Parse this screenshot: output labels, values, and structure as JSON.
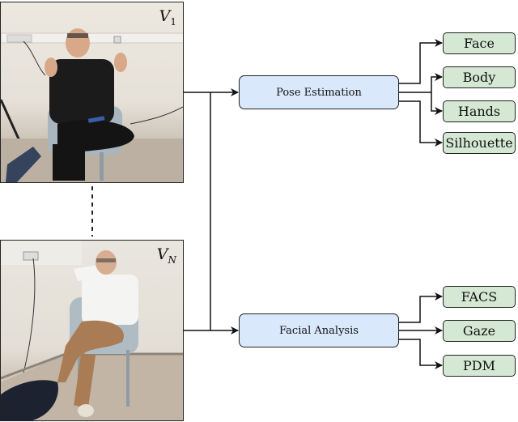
{
  "videos": [
    {
      "label": "V",
      "subscript": "1",
      "subscript_italic": false,
      "description": "participant in black t-shirt seated on chair gesturing"
    },
    {
      "label": "V",
      "subscript": "N",
      "subscript_italic": true,
      "description": "participant in white shirt and brown trousers seated on chair"
    }
  ],
  "processes": [
    {
      "label": "Pose Estimation",
      "outputs": [
        "Face",
        "Body",
        "Hands",
        "Silhouette"
      ]
    },
    {
      "label": "Facial Analysis",
      "outputs": [
        "FACS",
        "Gaze",
        "PDM"
      ]
    }
  ],
  "colors": {
    "process_fill": "#dae8fc",
    "output_fill": "#d5e8d4",
    "stroke": "#222222"
  }
}
